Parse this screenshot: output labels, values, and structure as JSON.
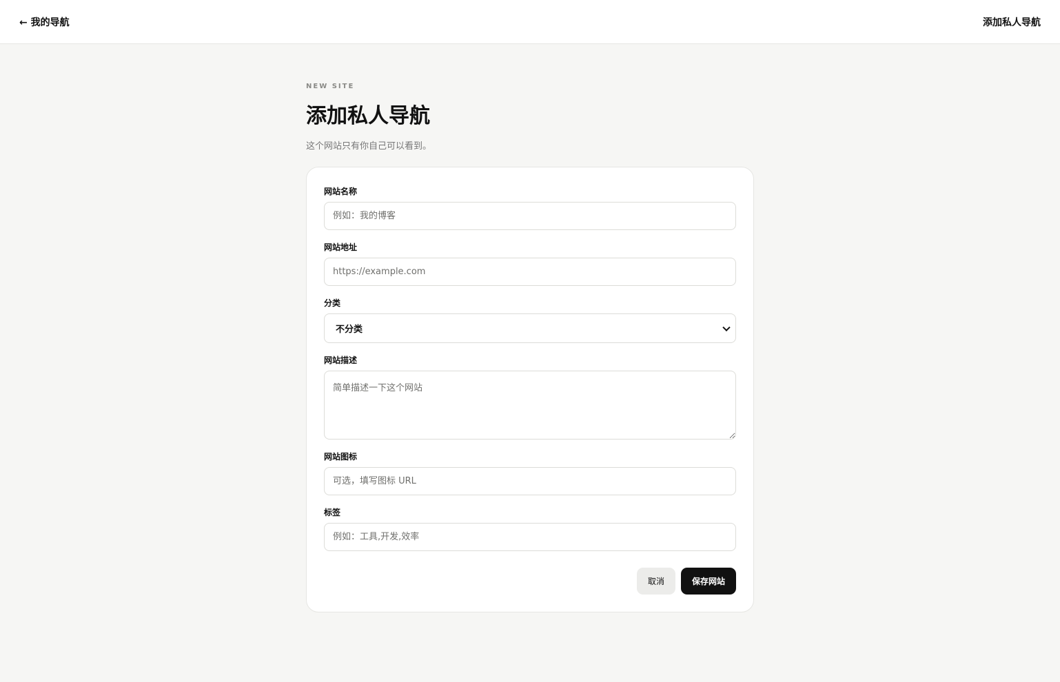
{
  "topbar": {
    "back_label": "← 我的导航",
    "title": "添加私人导航"
  },
  "header": {
    "eyebrow": "NEW SITE",
    "title": "添加私人导航",
    "subtitle": "这个网站只有你自己可以看到。"
  },
  "form": {
    "name": {
      "label": "网站名称",
      "placeholder": "例如：我的博客",
      "value": ""
    },
    "url": {
      "label": "网站地址",
      "placeholder": "https://example.com",
      "value": ""
    },
    "category": {
      "label": "分类",
      "selected": "不分类"
    },
    "description": {
      "label": "网站描述",
      "placeholder": "简单描述一下这个网站",
      "value": ""
    },
    "icon": {
      "label": "网站图标",
      "placeholder": "可选，填写图标 URL",
      "value": ""
    },
    "tags": {
      "label": "标签",
      "placeholder": "例如：工具,开发,效率",
      "value": ""
    }
  },
  "actions": {
    "cancel_label": "取消",
    "save_label": "保存网站"
  }
}
